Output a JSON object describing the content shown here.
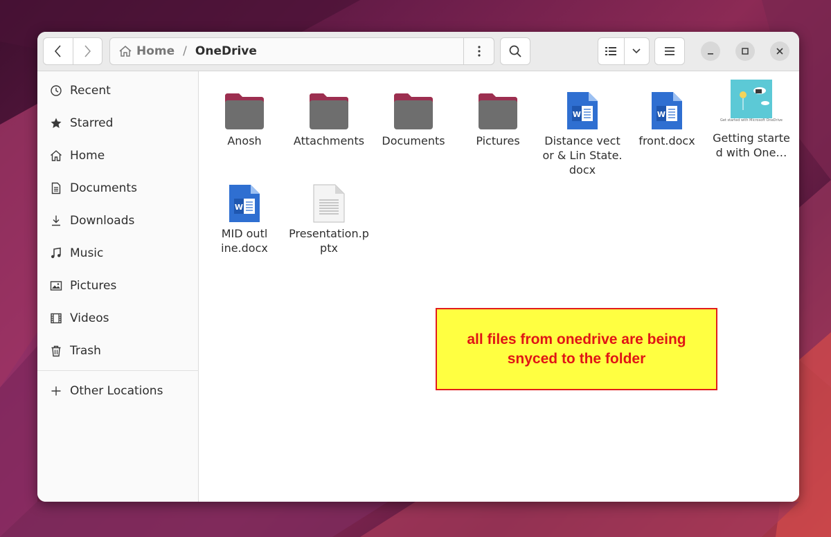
{
  "header": {
    "breadcrumb": {
      "home": "Home",
      "separator": "/",
      "current": "OneDrive"
    },
    "icons": [
      "back-icon",
      "forward-icon",
      "home-icon",
      "kebab-icon",
      "search-icon",
      "list-view-icon",
      "chevron-down-icon",
      "hamburger-icon",
      "minimize-icon",
      "maximize-icon",
      "close-icon"
    ]
  },
  "sidebar": {
    "items": [
      {
        "label": "Recent",
        "icon": "clock-icon"
      },
      {
        "label": "Starred",
        "icon": "star-icon"
      },
      {
        "label": "Home",
        "icon": "home-icon"
      },
      {
        "label": "Documents",
        "icon": "document-icon"
      },
      {
        "label": "Downloads",
        "icon": "download-icon"
      },
      {
        "label": "Music",
        "icon": "music-icon"
      },
      {
        "label": "Pictures",
        "icon": "picture-icon"
      },
      {
        "label": "Videos",
        "icon": "film-icon"
      },
      {
        "label": "Trash",
        "icon": "trash-icon"
      }
    ],
    "other": {
      "label": "Other Locations",
      "icon": "plus-icon"
    }
  },
  "files": [
    {
      "name": "Anosh",
      "type": "folder"
    },
    {
      "name": "Attachments",
      "type": "folder"
    },
    {
      "name": "Documents",
      "type": "folder"
    },
    {
      "name": "Pictures",
      "type": "folder"
    },
    {
      "name": "Distance vector & Lin State.docx",
      "type": "docx"
    },
    {
      "name": "front.docx",
      "type": "docx"
    },
    {
      "name": "Getting started with One…",
      "type": "pdf-thumb",
      "thumb_caption": "Get started with Microsoft OneDrive"
    },
    {
      "name": "MID outline.docx",
      "type": "docx"
    },
    {
      "name": "Presentation.pptx",
      "type": "generic"
    }
  ],
  "annotation": {
    "text": "all files from onedrive are being snyced to the folder",
    "background": "#ffff41",
    "border": "#e11c1c",
    "color": "#e01515"
  },
  "colors": {
    "folder": "#6e6e6e",
    "folder_tab": "#c9603f",
    "word_blue": "#2f6fd1"
  }
}
